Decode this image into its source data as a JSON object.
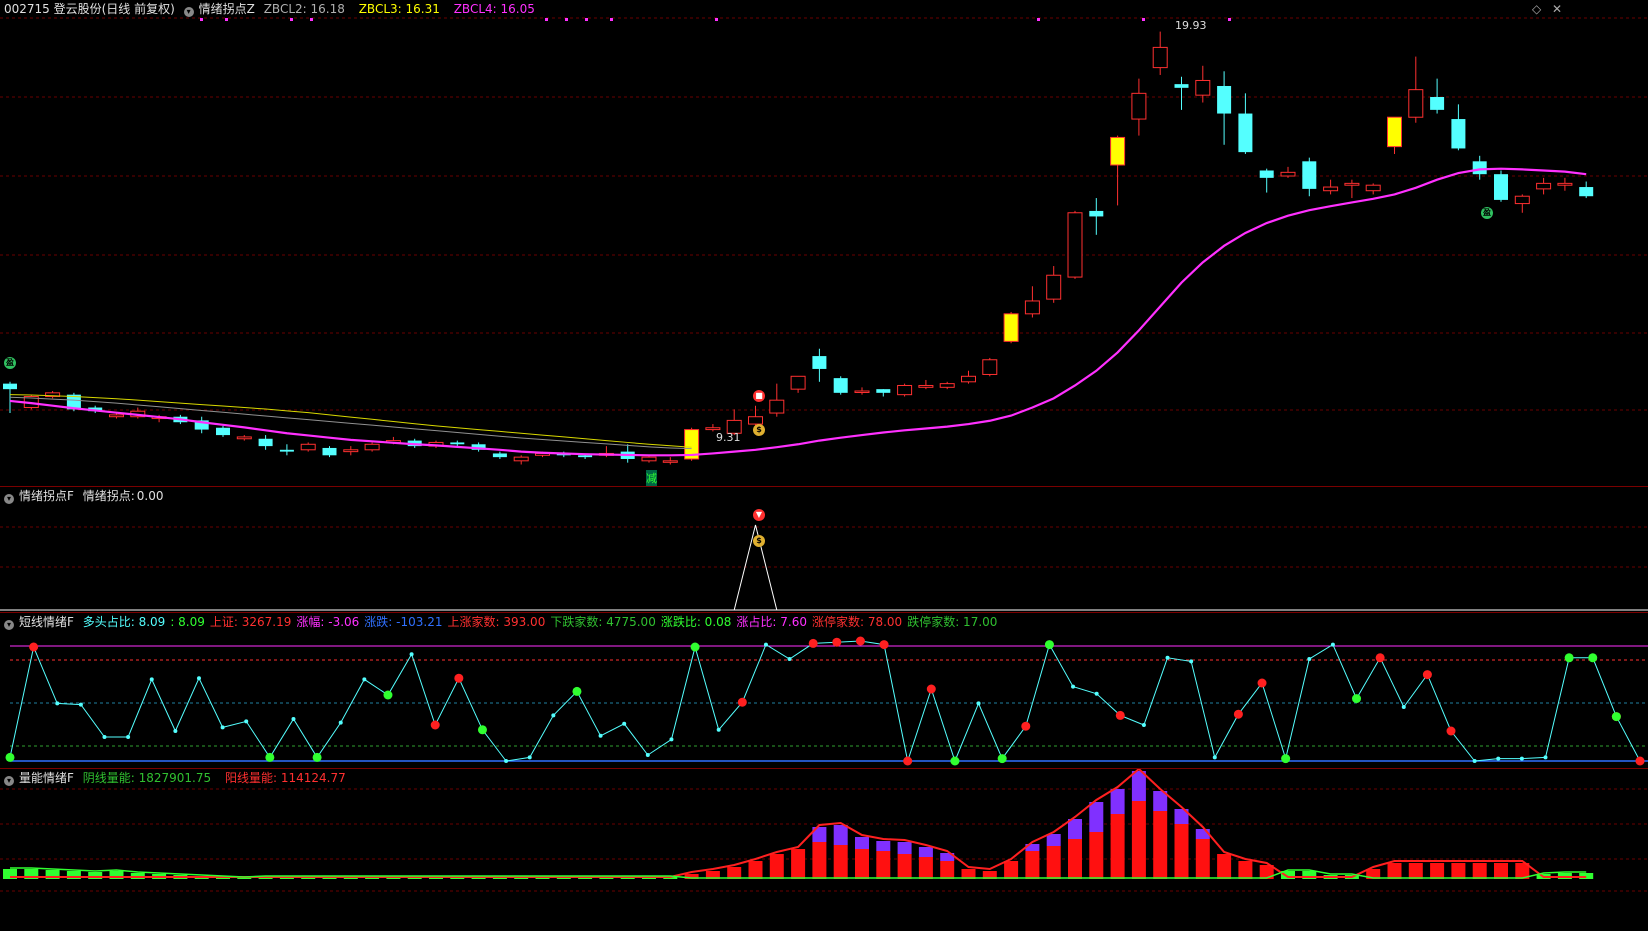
{
  "main": {
    "stock": "002715 登云股份(日线 前复权)",
    "indicator": "情绪拐点Z",
    "zbcl2_label": "ZBCL2:",
    "zbcl2_value": "16.18",
    "zbcl3_label": "ZBCL3:",
    "zbcl3_value": "16.31",
    "zbcl4_label": "ZBCL4:",
    "zbcl4_value": "16.05",
    "high_label": "19.93",
    "low_label": "9.31",
    "jian_label": "减",
    "ying_label": "盈",
    "colors": {
      "up": "#ff3030",
      "down": "#54ffff",
      "limit": "#ffff00",
      "ma": "#ff30ff"
    }
  },
  "candles": [
    [
      10.35,
      10.2,
      9.55,
      10.4
    ],
    [
      9.7,
      10.0,
      9.65,
      10.05
    ],
    [
      10.0,
      10.1,
      9.95,
      10.15
    ],
    [
      10.05,
      9.65,
      9.6,
      10.1
    ],
    [
      9.7,
      9.6,
      9.55,
      9.75
    ],
    [
      9.45,
      9.5,
      9.4,
      9.55
    ],
    [
      9.45,
      9.6,
      9.4,
      9.7
    ],
    [
      9.4,
      9.45,
      9.3,
      9.5
    ],
    [
      9.45,
      9.3,
      9.25,
      9.5
    ],
    [
      9.35,
      9.1,
      9.0,
      9.45
    ],
    [
      9.15,
      8.95,
      8.9,
      9.2
    ],
    [
      8.85,
      8.9,
      8.8,
      8.95
    ],
    [
      8.85,
      8.65,
      8.55,
      8.95
    ],
    [
      8.55,
      8.5,
      8.4,
      8.7
    ],
    [
      8.55,
      8.7,
      8.5,
      8.75
    ],
    [
      8.6,
      8.4,
      8.35,
      8.65
    ],
    [
      8.5,
      8.55,
      8.4,
      8.65
    ],
    [
      8.55,
      8.7,
      8.5,
      8.75
    ],
    [
      8.75,
      8.8,
      8.7,
      8.9
    ],
    [
      8.8,
      8.65,
      8.6,
      8.85
    ],
    [
      8.65,
      8.75,
      8.6,
      8.8
    ],
    [
      8.75,
      8.7,
      8.65,
      8.8
    ],
    [
      8.7,
      8.55,
      8.5,
      8.75
    ],
    [
      8.45,
      8.35,
      8.3,
      8.5
    ],
    [
      8.25,
      8.35,
      8.15,
      8.4
    ],
    [
      8.4,
      8.45,
      8.35,
      8.5
    ],
    [
      8.45,
      8.4,
      8.35,
      8.5
    ],
    [
      8.4,
      8.35,
      8.3,
      8.45
    ],
    [
      8.4,
      8.45,
      8.35,
      8.65
    ],
    [
      8.5,
      8.3,
      8.2,
      8.7
    ],
    [
      8.25,
      8.35,
      8.2,
      8.4
    ],
    [
      8.25,
      8.25,
      8.15,
      8.35
    ],
    [
      8.3,
      9.1,
      8.25,
      9.15
    ],
    [
      9.1,
      9.15,
      9.05,
      9.25
    ],
    [
      9.0,
      9.35,
      8.95,
      9.65
    ],
    [
      9.25,
      9.45,
      9.15,
      9.75
    ],
    [
      9.55,
      9.9,
      9.45,
      10.35
    ],
    [
      10.2,
      10.55,
      10.1,
      10.55
    ],
    [
      11.1,
      10.75,
      10.4,
      11.3
    ],
    [
      10.5,
      10.1,
      10.05,
      10.55
    ],
    [
      10.15,
      10.15,
      10.05,
      10.25
    ],
    [
      10.2,
      10.1,
      10.0,
      10.2
    ],
    [
      10.05,
      10.3,
      10.0,
      10.35
    ],
    [
      10.25,
      10.3,
      10.2,
      10.45
    ],
    [
      10.25,
      10.35,
      10.2,
      10.4
    ],
    [
      10.4,
      10.55,
      10.35,
      10.7
    ],
    [
      10.6,
      11.0,
      10.55,
      11.05
    ],
    [
      11.5,
      12.25,
      11.45,
      12.3
    ],
    [
      12.25,
      12.6,
      12.15,
      13.0
    ],
    [
      12.65,
      13.3,
      12.55,
      13.55
    ],
    [
      13.25,
      15.0,
      13.2,
      15.05
    ],
    [
      15.05,
      14.9,
      14.4,
      15.4
    ],
    [
      16.3,
      17.05,
      15.2,
      17.1
    ],
    [
      17.55,
      18.25,
      17.1,
      18.65
    ],
    [
      18.95,
      19.5,
      18.75,
      19.93
    ],
    [
      18.5,
      18.4,
      17.8,
      18.7
    ],
    [
      18.2,
      18.6,
      18.0,
      19.0
    ],
    [
      18.45,
      17.7,
      16.85,
      18.85
    ],
    [
      17.7,
      16.65,
      16.6,
      18.25
    ],
    [
      16.15,
      15.95,
      15.55,
      16.2
    ],
    [
      16.0,
      16.1,
      15.95,
      16.25
    ],
    [
      16.4,
      15.65,
      15.45,
      16.5
    ],
    [
      15.6,
      15.7,
      15.5,
      15.9
    ],
    [
      15.75,
      15.8,
      15.4,
      15.9
    ],
    [
      15.6,
      15.75,
      15.5,
      15.8
    ],
    [
      16.8,
      17.6,
      16.6,
      17.6
    ],
    [
      17.6,
      18.35,
      17.45,
      19.25
    ],
    [
      18.15,
      17.8,
      17.7,
      18.65
    ],
    [
      17.55,
      16.75,
      16.7,
      17.95
    ],
    [
      16.4,
      16.05,
      15.9,
      16.55
    ],
    [
      16.05,
      15.35,
      15.3,
      16.15
    ],
    [
      15.25,
      15.45,
      15.0,
      15.5
    ],
    [
      15.65,
      15.8,
      15.5,
      15.95
    ],
    [
      15.75,
      15.8,
      15.6,
      15.95
    ],
    [
      15.7,
      15.45,
      15.4,
      15.85
    ]
  ],
  "limit_up_days": [
    32,
    47,
    52,
    65
  ],
  "ma_line": [
    9.88,
    9.82,
    9.75,
    9.68,
    9.62,
    9.56,
    9.5,
    9.44,
    9.38,
    9.3,
    9.23,
    9.16,
    9.08,
    9.0,
    8.94,
    8.88,
    8.82,
    8.78,
    8.74,
    8.7,
    8.67,
    8.63,
    8.59,
    8.55,
    8.5,
    8.47,
    8.45,
    8.43,
    8.42,
    8.41,
    8.4,
    8.4,
    8.41,
    8.45,
    8.5,
    8.55,
    8.62,
    8.7,
    8.8,
    8.88,
    8.95,
    9.02,
    9.08,
    9.13,
    9.18,
    9.25,
    9.34,
    9.48,
    9.7,
    9.95,
    10.3,
    10.7,
    11.2,
    11.8,
    12.45,
    13.1,
    13.65,
    14.1,
    14.45,
    14.72,
    14.92,
    15.07,
    15.18,
    15.28,
    15.38,
    15.5,
    15.68,
    15.9,
    16.08,
    16.18,
    16.2,
    16.18,
    16.15,
    16.12,
    16.05
  ],
  "yellow_line": [
    10.05,
    10.04,
    10.02,
    10.0,
    9.97,
    9.94,
    9.9,
    9.86,
    9.82,
    9.78,
    9.74,
    9.7,
    9.66,
    9.61,
    9.56,
    9.5,
    9.44,
    9.38,
    9.32,
    9.26,
    9.2,
    9.15,
    9.1,
    9.05,
    9.0,
    8.95,
    8.9,
    8.85,
    8.8,
    8.75,
    8.7,
    8.66,
    8.62
  ],
  "gray_line": [
    9.98,
    9.96,
    9.93,
    9.9,
    9.86,
    9.82,
    9.77,
    9.72,
    9.67,
    9.62,
    9.57,
    9.52,
    9.47,
    9.42,
    9.37,
    9.32,
    9.27,
    9.22,
    9.17,
    9.12,
    9.07,
    9.02,
    8.97,
    8.92,
    8.87,
    8.83,
    8.79,
    8.75,
    8.71,
    8.67,
    8.63,
    8.6,
    8.58
  ],
  "emotion_pane": {
    "title": "情绪拐点F",
    "label": "情绪拐点:",
    "value": "0.00",
    "peak_day": 35
  },
  "short_pane": {
    "title": "短线情绪F",
    "items": [
      {
        "label": "多头占比:",
        "value": "8.09",
        "color": "#54ffff"
      },
      {
        "label": ":",
        "value": "8.09",
        "color": "#30ff30"
      },
      {
        "label": "上证:",
        "value": "3267.19",
        "color": "#ff3030"
      },
      {
        "label": "涨幅:",
        "value": "-3.06",
        "color": "#ff30ff"
      },
      {
        "label": "涨跌:",
        "value": "-103.21",
        "color": "#3070ff"
      },
      {
        "label": "上涨家数:",
        "value": "393.00",
        "color": "#ff3030"
      },
      {
        "label": "下跌家数:",
        "value": "4775.00",
        "color": "#30c030"
      },
      {
        "label": "涨跌比:",
        "value": "0.08",
        "color": "#30ff30"
      },
      {
        "label": "涨占比:",
        "value": "7.60",
        "color": "#ff30ff"
      },
      {
        "label": "涨停家数:",
        "value": "78.00",
        "color": "#ff3030"
      },
      {
        "label": "跌停家数:",
        "value": "17.00",
        "color": "#30c030"
      }
    ],
    "line": [
      3,
      95,
      48,
      47,
      20,
      20,
      68,
      25,
      69,
      28,
      33,
      3,
      35,
      3,
      32,
      68,
      55,
      89,
      30,
      69,
      26,
      0,
      3,
      38,
      58,
      21,
      31,
      5,
      18,
      95,
      26,
      49,
      97,
      85,
      98,
      99,
      100,
      97,
      0,
      60,
      0,
      48,
      2,
      29,
      97,
      62,
      56,
      38,
      30,
      86,
      83,
      3,
      39,
      65,
      2,
      85,
      97,
      52,
      86,
      45,
      72,
      25,
      0,
      2,
      2,
      3,
      86,
      86,
      37,
      0
    ],
    "red_days": [
      1,
      18,
      19,
      31,
      34,
      35,
      36,
      37,
      38,
      39,
      43,
      47,
      52,
      53,
      58,
      60,
      61,
      68,
      69
    ],
    "green_days": [
      0,
      11,
      13,
      16,
      20,
      24,
      29,
      40,
      42,
      44,
      54,
      57,
      66,
      67,
      68,
      72
    ]
  },
  "volume_pane": {
    "title": "量能情绪F",
    "yin_label": "阴线量能:",
    "yin_value": "1827901.75",
    "yang_label": "阳线量能:",
    "yang_value": "114124.77",
    "red_bars": [
      0,
      0,
      0,
      0,
      0,
      0,
      0,
      0,
      0,
      0,
      0,
      0,
      0,
      0,
      0,
      0,
      0,
      0,
      0,
      0,
      0,
      0,
      0,
      0,
      0,
      0,
      0,
      0,
      0,
      0,
      0,
      0,
      5,
      8,
      12,
      18,
      25,
      30,
      37,
      34,
      30,
      28,
      25,
      22,
      18,
      10,
      8,
      18,
      28,
      33,
      40,
      47,
      65,
      78,
      68,
      55,
      40,
      25,
      18,
      14,
      0,
      0,
      0,
      0,
      10,
      16,
      16,
      16,
      16,
      16,
      16,
      16,
      0,
      0,
      0
    ],
    "purple_bars": [
      0,
      0,
      0,
      0,
      0,
      0,
      0,
      0,
      0,
      0,
      0,
      0,
      0,
      0,
      0,
      0,
      0,
      0,
      0,
      0,
      0,
      0,
      0,
      0,
      0,
      0,
      0,
      0,
      0,
      0,
      0,
      0,
      0,
      0,
      0,
      0,
      0,
      0,
      15,
      20,
      12,
      10,
      12,
      10,
      8,
      0,
      0,
      0,
      7,
      12,
      20,
      30,
      25,
      30,
      20,
      15,
      10,
      0,
      0,
      0,
      0,
      0,
      0,
      0,
      0,
      0,
      0,
      0,
      0,
      0,
      0,
      0,
      0,
      0,
      0
    ],
    "green_bars": [
      10,
      10,
      9,
      8,
      7,
      8,
      6,
      5,
      4,
      3,
      2,
      1,
      2,
      2,
      2,
      2,
      2,
      2,
      2,
      2,
      2,
      2,
      2,
      2,
      2,
      2,
      2,
      2,
      2,
      2,
      2,
      2,
      0,
      0,
      0,
      0,
      0,
      0,
      0,
      0,
      0,
      0,
      0,
      0,
      0,
      0,
      0,
      0,
      0,
      0,
      0,
      0,
      0,
      0,
      0,
      0,
      0,
      0,
      0,
      0,
      8,
      8,
      4,
      4,
      0,
      0,
      0,
      0,
      0,
      0,
      0,
      0,
      5,
      6,
      6
    ]
  }
}
